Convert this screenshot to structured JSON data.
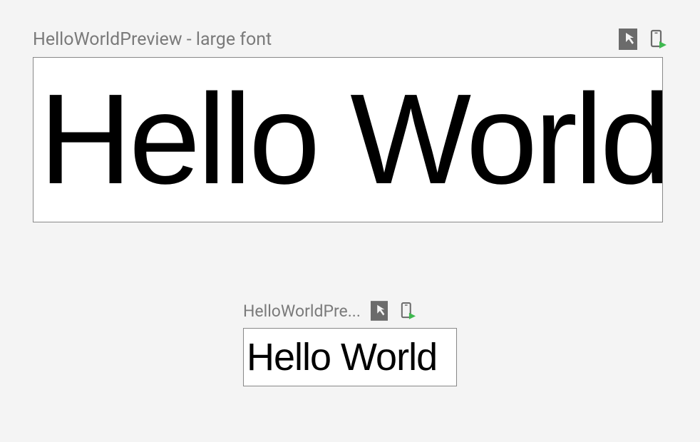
{
  "previews": [
    {
      "title": "HelloWorldPreview - large font",
      "text": "Hello World"
    },
    {
      "title": "HelloWorldPre...",
      "text": "Hello World"
    }
  ]
}
